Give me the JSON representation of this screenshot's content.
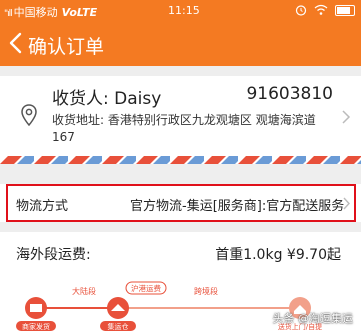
{
  "status_bar": {
    "signal": "\"ıll",
    "carrier": "中国移动",
    "network": "VoLTE",
    "time": "11:15"
  },
  "nav": {
    "title": "确认订单"
  },
  "receiver": {
    "label": "收货人:",
    "name": "Daisy",
    "phone": "91603810",
    "address_label": "收货地址:",
    "address": "香港特别行政区九龙观塘区 观塘海滨道167"
  },
  "logistics": {
    "label": "物流方式",
    "value": "官方物流-集运[服务商]:官方配送服务"
  },
  "overseas": {
    "label": "海外段运费:",
    "value": "首重1.0kg ¥9.70起"
  },
  "route": {
    "segments": [
      "大陆段",
      "沪港运费",
      "跨境段"
    ],
    "stops": [
      "商家发货",
      "集运仓",
      "送货上门/自提"
    ]
  },
  "watermark": "头条 @淘逗集运",
  "colors": {
    "brand": "#f47a22",
    "highlight": "#e0101a",
    "route_red": "#e8503a"
  }
}
